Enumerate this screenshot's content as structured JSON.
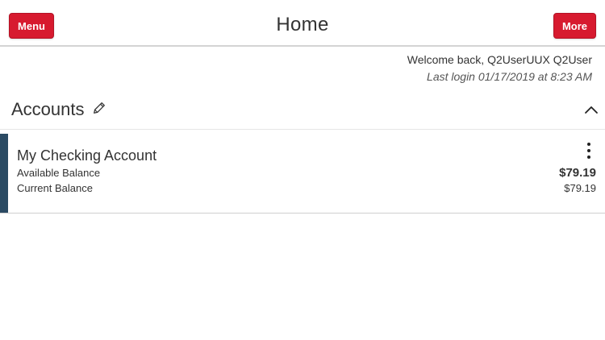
{
  "header": {
    "menu_label": "Menu",
    "title": "Home",
    "more_label": "More"
  },
  "welcome": {
    "greeting": "Welcome back, Q2UserUUX Q2User",
    "last_login": "Last login 01/17/2019 at 8:23 AM"
  },
  "accounts_section": {
    "title": "Accounts",
    "edit_icon": "pencil-icon",
    "collapse_icon": "chevron-up-icon"
  },
  "accounts": [
    {
      "name": "My Checking Account",
      "available_label": "Available Balance",
      "available_value": "$79.19",
      "current_label": "Current Balance",
      "current_value": "$79.19",
      "actions_icon": "kebab-menu-icon"
    }
  ],
  "colors": {
    "brand_red": "#d71a2f",
    "account_stripe": "#2b4a63",
    "text": "#333333"
  }
}
